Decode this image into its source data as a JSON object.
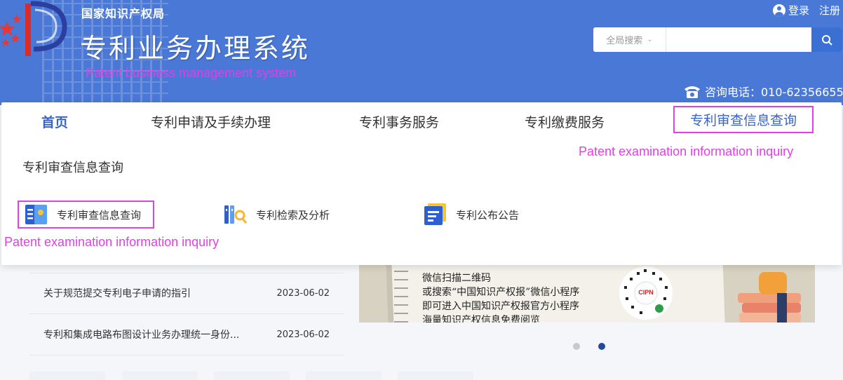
{
  "header": {
    "org_name": "国家知识产权局",
    "system_title": "专利业务办理系统",
    "system_subtitle_en": "Patent business management system",
    "login_label": "登录",
    "register_label": "注册",
    "search": {
      "scope_label": "全局搜索",
      "value": "",
      "placeholder": ""
    },
    "hotline": "咨询电话：010-62356655"
  },
  "nav": {
    "items": [
      {
        "label": "首页"
      },
      {
        "label": "专利申请及手续办理"
      },
      {
        "label": "专利事务服务"
      },
      {
        "label": "专利缴费服务"
      },
      {
        "label": "专利审查信息查询"
      }
    ],
    "annotation_en": "Patent examination information inquiry"
  },
  "dropdown": {
    "heading": "专利审查信息查询",
    "links": [
      {
        "label": "专利审查信息查询",
        "icon": "document-book-icon"
      },
      {
        "label": "专利检索及分析",
        "icon": "books-search-icon"
      },
      {
        "label": "专利公布公告",
        "icon": "announcement-document-icon"
      }
    ],
    "annotation_en": "Patent examination information inquiry"
  },
  "news": [
    {
      "title": "关于规范提交专利电子申请的指引",
      "date": "2023-06-02"
    },
    {
      "title": "专利和集成电路布图设计业务办理统一身份...",
      "date": "2023-06-02"
    }
  ],
  "banner": {
    "lines": [
      "微信扫描二维码",
      "或搜索“中国知识产权报”微信小程序",
      "即可进入中国知识产权报官方小程序",
      "海量知识产权信息免费阅览"
    ],
    "qr_label": "CIPN"
  },
  "carousel": {
    "count": 2,
    "active_index": 1
  },
  "colors": {
    "header_bg": "#4a78d6",
    "accent": "#3a64c3",
    "annotation": "#e040e6"
  }
}
